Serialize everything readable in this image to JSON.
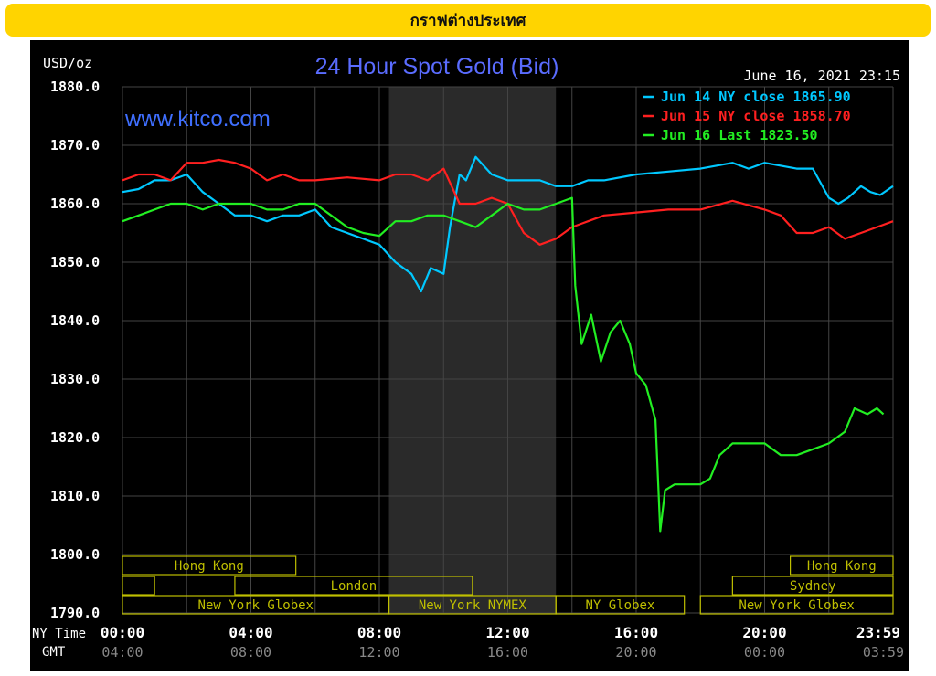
{
  "banner": {
    "title": "กราฟต่างประเทศ"
  },
  "chart_data": {
    "type": "line",
    "title": "24 Hour Spot Gold (Bid)",
    "watermark": "www.kitco.com",
    "date_label": "June 16, 2021 23:15",
    "ylabel": "USD/oz",
    "ylim": [
      1790,
      1880
    ],
    "yticks": [
      "1880.0",
      "1870.0",
      "1860.0",
      "1850.0",
      "1840.0",
      "1830.0",
      "1820.0",
      "1810.0",
      "1800.0",
      "1790.0"
    ],
    "x_ny_label": "NY Time",
    "x_gmt_label": "GMT",
    "x_ny": [
      "00:00",
      "04:00",
      "08:00",
      "12:00",
      "16:00",
      "20:00",
      "23:59"
    ],
    "x_gmt": [
      "04:00",
      "08:00",
      "12:00",
      "16:00",
      "20:00",
      "00:00",
      "03:59"
    ],
    "shaded_hours": [
      8.3,
      13.5
    ],
    "colors": {
      "bg": "#000000",
      "grid": "#555555",
      "axis_text": "#ffffff",
      "title": "#5a6cff",
      "watermark": "#3f6fff",
      "session": "#bfbf00"
    },
    "legend": [
      {
        "label": "Jun 14 NY close 1865.90",
        "color": "#00c8ff"
      },
      {
        "label": "Jun 15 NY close 1858.70",
        "color": "#ff2020"
      },
      {
        "label": "Jun 16 Last 1823.50",
        "color": "#22ee22"
      }
    ],
    "series": [
      {
        "name": "Jun 14 NY close 1865.90",
        "color": "#00c8ff",
        "points": [
          [
            0,
            1862
          ],
          [
            0.5,
            1862.5
          ],
          [
            1,
            1864
          ],
          [
            1.5,
            1864
          ],
          [
            2,
            1865
          ],
          [
            2.5,
            1862
          ],
          [
            3,
            1860
          ],
          [
            3.5,
            1858
          ],
          [
            4,
            1858
          ],
          [
            4.5,
            1857
          ],
          [
            5,
            1858
          ],
          [
            5.5,
            1858
          ],
          [
            6,
            1859
          ],
          [
            6.5,
            1856
          ],
          [
            7,
            1855
          ],
          [
            7.5,
            1854
          ],
          [
            8,
            1853
          ],
          [
            8.5,
            1850
          ],
          [
            9,
            1848
          ],
          [
            9.3,
            1845
          ],
          [
            9.6,
            1849
          ],
          [
            10,
            1848
          ],
          [
            10.2,
            1856
          ],
          [
            10.5,
            1865
          ],
          [
            10.7,
            1864
          ],
          [
            11,
            1868
          ],
          [
            11.5,
            1865
          ],
          [
            12,
            1864
          ],
          [
            12.5,
            1864
          ],
          [
            13,
            1864
          ],
          [
            13.5,
            1863
          ],
          [
            14,
            1863
          ],
          [
            14.5,
            1864
          ],
          [
            15,
            1864
          ],
          [
            16,
            1865
          ],
          [
            17,
            1865.5
          ],
          [
            18,
            1866
          ],
          [
            19,
            1867
          ],
          [
            19.5,
            1866
          ],
          [
            20,
            1867
          ],
          [
            21,
            1866
          ],
          [
            21.5,
            1866
          ],
          [
            22,
            1861
          ],
          [
            22.3,
            1860
          ],
          [
            22.6,
            1861
          ],
          [
            23,
            1863
          ],
          [
            23.3,
            1862
          ],
          [
            23.6,
            1861.5
          ],
          [
            24,
            1863
          ]
        ]
      },
      {
        "name": "Jun 15 NY close 1858.70",
        "color": "#ff2020",
        "points": [
          [
            0,
            1864
          ],
          [
            0.5,
            1865
          ],
          [
            1,
            1865
          ],
          [
            1.5,
            1864
          ],
          [
            2,
            1867
          ],
          [
            2.5,
            1867
          ],
          [
            3,
            1867.5
          ],
          [
            3.5,
            1867
          ],
          [
            4,
            1866
          ],
          [
            4.5,
            1864
          ],
          [
            5,
            1865
          ],
          [
            5.5,
            1864
          ],
          [
            6,
            1864
          ],
          [
            7,
            1864.5
          ],
          [
            8,
            1864
          ],
          [
            8.5,
            1865
          ],
          [
            9,
            1865
          ],
          [
            9.5,
            1864
          ],
          [
            10,
            1866
          ],
          [
            10.5,
            1860
          ],
          [
            11,
            1860
          ],
          [
            11.5,
            1861
          ],
          [
            12,
            1860
          ],
          [
            12.5,
            1855
          ],
          [
            13,
            1853
          ],
          [
            13.5,
            1854
          ],
          [
            14,
            1856
          ],
          [
            14.5,
            1857
          ],
          [
            15,
            1858
          ],
          [
            16,
            1858.5
          ],
          [
            17,
            1859
          ],
          [
            18,
            1859
          ],
          [
            19,
            1860.5
          ],
          [
            20,
            1859
          ],
          [
            20.5,
            1858
          ],
          [
            21,
            1855
          ],
          [
            21.5,
            1855
          ],
          [
            22,
            1856
          ],
          [
            22.5,
            1854
          ],
          [
            23,
            1855
          ],
          [
            23.5,
            1856
          ],
          [
            24,
            1857
          ]
        ]
      },
      {
        "name": "Jun 16 Last 1823.50",
        "color": "#22ee22",
        "points": [
          [
            0,
            1857
          ],
          [
            0.5,
            1858
          ],
          [
            1,
            1859
          ],
          [
            1.5,
            1860
          ],
          [
            2,
            1860
          ],
          [
            2.5,
            1859
          ],
          [
            3,
            1860
          ],
          [
            3.5,
            1860
          ],
          [
            4,
            1860
          ],
          [
            4.5,
            1859
          ],
          [
            5,
            1859
          ],
          [
            5.5,
            1860
          ],
          [
            6,
            1860
          ],
          [
            6.5,
            1858
          ],
          [
            7,
            1856
          ],
          [
            7.5,
            1855
          ],
          [
            8,
            1854.5
          ],
          [
            8.5,
            1857
          ],
          [
            9,
            1857
          ],
          [
            9.5,
            1858
          ],
          [
            10,
            1858
          ],
          [
            10.5,
            1857
          ],
          [
            11,
            1856
          ],
          [
            11.5,
            1858
          ],
          [
            12,
            1860
          ],
          [
            12.5,
            1859
          ],
          [
            13,
            1859
          ],
          [
            13.5,
            1860
          ],
          [
            14,
            1861
          ],
          [
            14.1,
            1846
          ],
          [
            14.3,
            1836
          ],
          [
            14.6,
            1841
          ],
          [
            14.9,
            1833
          ],
          [
            15.2,
            1838
          ],
          [
            15.5,
            1840
          ],
          [
            15.8,
            1836
          ],
          [
            16,
            1831
          ],
          [
            16.3,
            1829
          ],
          [
            16.6,
            1823
          ],
          [
            16.75,
            1804
          ],
          [
            16.9,
            1811
          ],
          [
            17.2,
            1812
          ],
          [
            17.5,
            1812
          ],
          [
            18,
            1812
          ],
          [
            18.3,
            1813
          ],
          [
            18.6,
            1817
          ],
          [
            19,
            1819
          ],
          [
            19.5,
            1819
          ],
          [
            20,
            1819
          ],
          [
            20.5,
            1817
          ],
          [
            21,
            1817
          ],
          [
            21.5,
            1818
          ],
          [
            22,
            1819
          ],
          [
            22.5,
            1821
          ],
          [
            22.8,
            1825
          ],
          [
            23.2,
            1824
          ],
          [
            23.5,
            1825
          ],
          [
            23.7,
            1824
          ]
        ]
      }
    ],
    "sessions": [
      {
        "label": "Hong Kong",
        "row": 0,
        "start": 0,
        "end": 5.4
      },
      {
        "label": "Hong Kong",
        "row": 0,
        "start": 20.8,
        "end": 24
      },
      {
        "label": "",
        "row": 1,
        "start": 0,
        "end": 1
      },
      {
        "label": "London",
        "row": 1,
        "start": 3.5,
        "end": 10.9
      },
      {
        "label": "Sydney",
        "row": 1,
        "start": 19,
        "end": 24
      },
      {
        "label": "New York Globex",
        "row": 2,
        "start": 0,
        "end": 8.3
      },
      {
        "label": "New York NYMEX",
        "row": 2,
        "start": 8.3,
        "end": 13.5
      },
      {
        "label": "NY Globex",
        "row": 2,
        "start": 13.5,
        "end": 17.5
      },
      {
        "label": "New York Globex",
        "row": 2,
        "start": 18,
        "end": 24
      }
    ]
  }
}
